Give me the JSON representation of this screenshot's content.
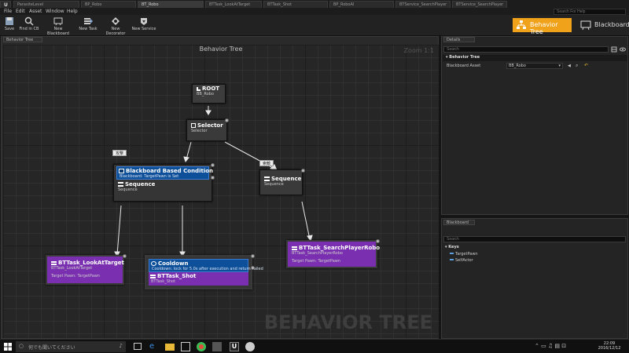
{
  "tabs": [
    "ParasiteLevel",
    "BP_Robo",
    "BT_Robo",
    "BTTask_LookAtTarget",
    "BTTask_Shot",
    "BP_RoboAI",
    "BTService_SearchPlayer",
    "BTService_SearchPlayer"
  ],
  "menu": {
    "file": "File",
    "edit": "Edit",
    "asset": "Asset",
    "window": "Window",
    "help": "Help",
    "search_help_placeholder": "Search For Help"
  },
  "toolbar": {
    "save": "Save",
    "find_in_cb": "Find in CB",
    "new_blackboard": "New Blackboard",
    "new_task": "New Task",
    "new_decorator": "New Decorator",
    "new_service": "New Service",
    "mode_bt": "Behavior Tree",
    "mode_bb": "Blackboard"
  },
  "graph": {
    "tab": "Behavior Tree",
    "title": "Behavior Tree",
    "zoom": "Zoom 1:1",
    "watermark": "BEHAVIOR TREE",
    "root": {
      "title": "ROOT",
      "sub": "BB_Robo"
    },
    "selector": {
      "title": "Selector",
      "sub": "Selector"
    },
    "note_left": "攻撃",
    "note_right": "索敵",
    "seq_left": {
      "decorator_title": "Blackboard Based Condition",
      "decorator_sub": "Blackboard: TargetPawn is Set",
      "title": "Sequence",
      "sub": "Sequence"
    },
    "seq_right": {
      "title": "Sequence",
      "sub": "Sequence"
    },
    "look": {
      "title": "BTTask_LookAtTarget",
      "sub": "BTTask_LookAtTarget",
      "prop": "Target Pawn: TargetPawn"
    },
    "shot": {
      "decorator_title": "Cooldown",
      "decorator_sub": "Cooldown: lock for 5.0s after execution and return Failed",
      "title": "BTTask_Shot",
      "sub": "BTTask_Shot"
    },
    "search": {
      "title": "BTTask_SearchPlayerRobo",
      "sub": "BTTask_SearchPlayerRobo",
      "prop": "Target Pawn: TargetPawn"
    }
  },
  "details": {
    "tab": "Details",
    "search_placeholder": "Search",
    "section": "Behavior Tree",
    "prop_label": "Blackboard Asset",
    "prop_value": "BB_Robo"
  },
  "blackboard": {
    "tab": "Blackboard",
    "search_placeholder": "Search",
    "section": "Keys",
    "keys": [
      "TargetPawn",
      "SelfActor"
    ]
  },
  "taskbar": {
    "search_placeholder": "何でも聞いてください",
    "time": "22:09",
    "date": "2016/12/12"
  },
  "colors": {
    "accent_orange": "#f0a21b",
    "decorator_blue": "#0e4f99",
    "task_purple": "#7a2fb0"
  }
}
